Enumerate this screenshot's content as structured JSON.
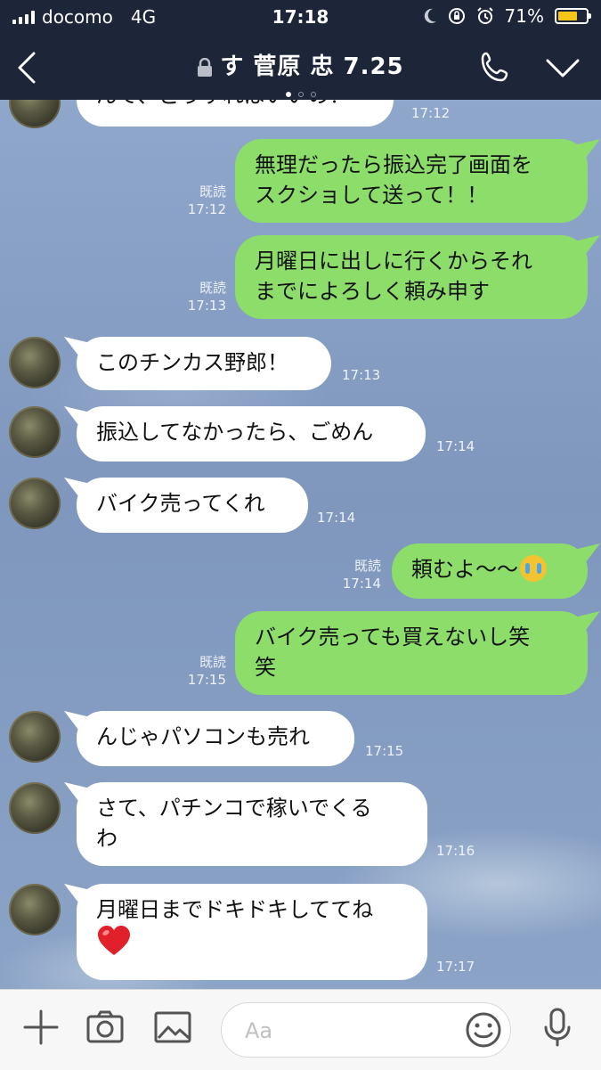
{
  "status": {
    "carrier": "docomo",
    "network": "4G",
    "time": "17:18",
    "battery": "71%",
    "battery_level": 0.71
  },
  "header": {
    "title": "す 菅原 忠 7.25",
    "page_dots": 3,
    "active_dot": 0,
    "icons": [
      "back-icon",
      "lock-icon",
      "phone-icon",
      "chevron-down-icon"
    ]
  },
  "messages": [
    {
      "side": "in",
      "text": "んで、どうすればいいの？",
      "time": "17:12"
    },
    {
      "side": "out",
      "text": "無理だったら振込完了画面を\nスクショして送って！！",
      "read": "既読",
      "time": "17:12"
    },
    {
      "side": "out",
      "text": "月曜日に出しに行くからそれ\nまでによろしく頼み申す",
      "read": "既読",
      "time": "17:13"
    },
    {
      "side": "in",
      "text": "このチンカス野郎！",
      "time": "17:13"
    },
    {
      "side": "in",
      "text": "振込してなかったら、ごめん",
      "time": "17:14"
    },
    {
      "side": "in",
      "text": "バイク売ってくれ",
      "time": "17:14"
    },
    {
      "side": "out",
      "text": "頼むよ〜〜",
      "emoji": "crying-face-emoji",
      "read": "既読",
      "time": "17:14"
    },
    {
      "side": "out",
      "text": "バイク売っても買えないし笑\n笑",
      "read": "既読",
      "time": "17:15"
    },
    {
      "side": "in",
      "text": "んじゃパソコンも売れ",
      "time": "17:15"
    },
    {
      "side": "in",
      "text": "さて、パチンコで稼いでくる\nわ",
      "time": "17:16"
    },
    {
      "side": "in",
      "text": "月曜日までドキドキしててね",
      "emoji": "red-heart-emoji",
      "time": "17:17"
    }
  ],
  "input": {
    "placeholder": "Aa",
    "icons": [
      "plus-icon",
      "camera-icon",
      "image-icon",
      "smile-icon",
      "microphone-icon"
    ]
  },
  "colors": {
    "header_bg": "#1d2538",
    "chat_bg": "#8aa2c4",
    "outgoing_bubble": "#8cdd6a",
    "incoming_bubble": "#ffffff",
    "battery_fill": "#f5c518"
  }
}
